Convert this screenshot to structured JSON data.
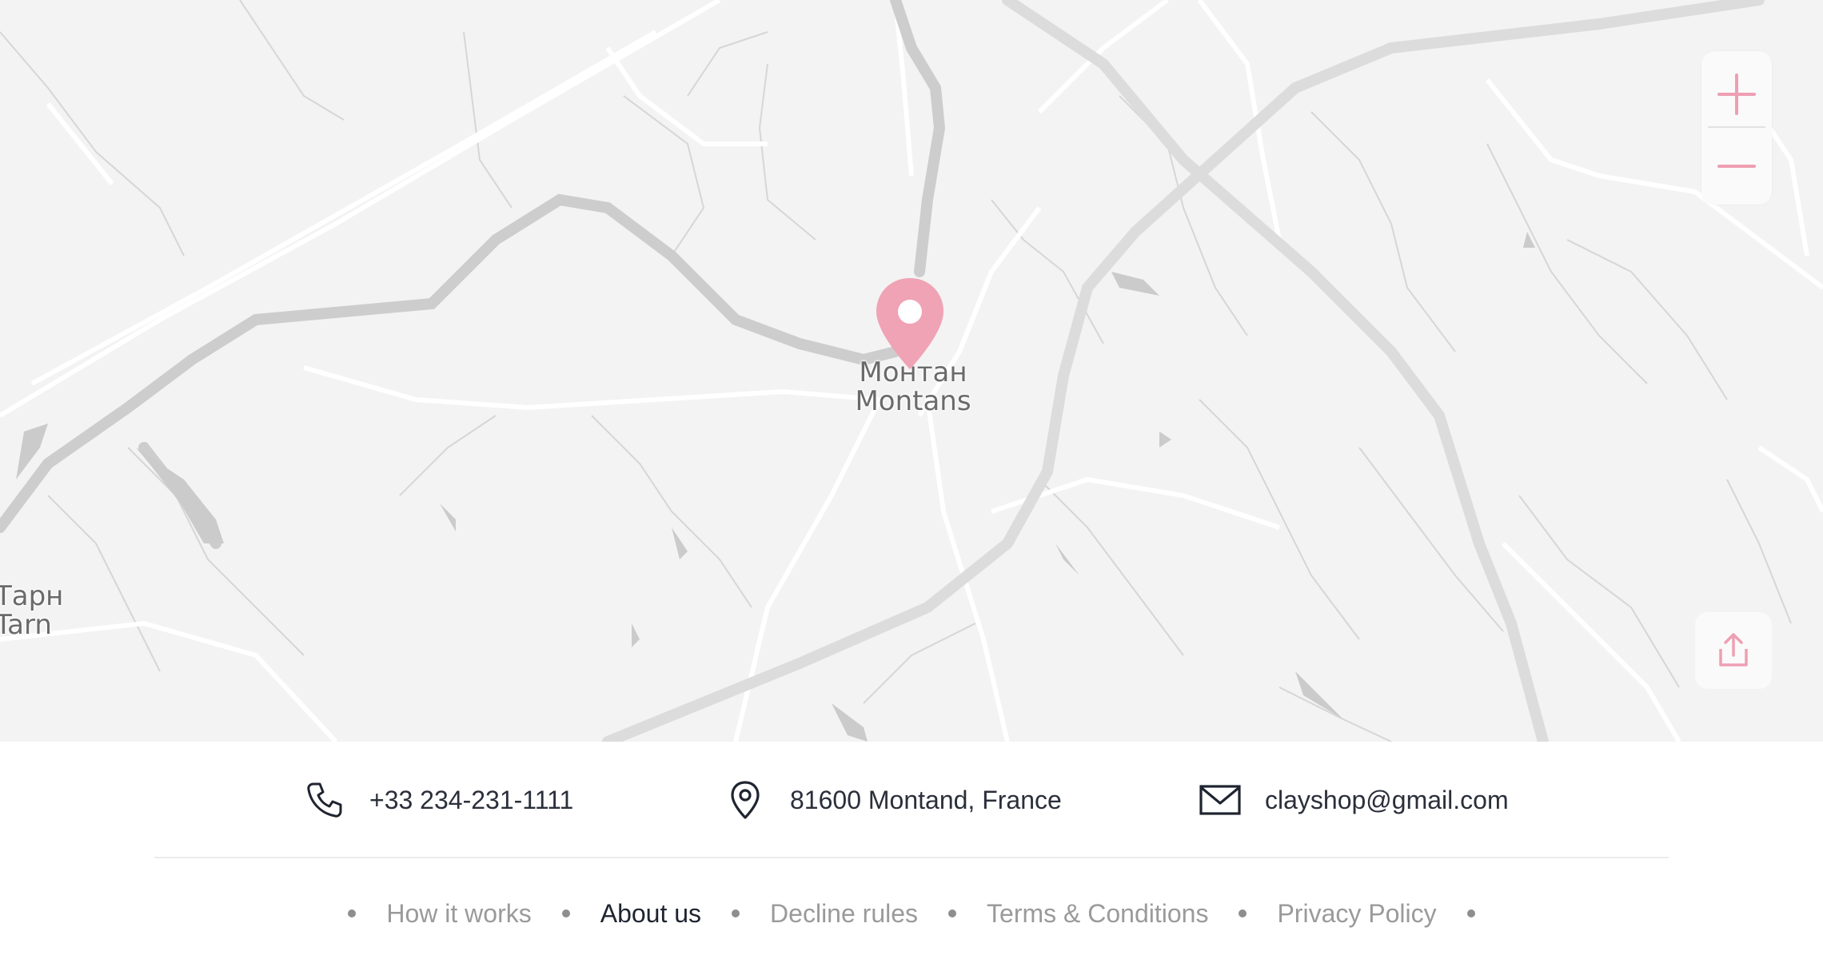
{
  "map": {
    "place_main_ru": "Монтан",
    "place_main_en": "Montans",
    "place_edge_ru": "Тарн",
    "place_edge_en": "Tarn",
    "marker_color": "#f0a3b5",
    "zoom_in_icon": "plus-icon",
    "zoom_out_icon": "minus-icon",
    "share_icon": "share-icon"
  },
  "contacts": {
    "phone": "+33 234-231-1111",
    "address": "81600 Montand, France",
    "email": "clayshop@gmail.com",
    "phone_icon": "phone-icon",
    "address_icon": "location-pin-icon",
    "email_icon": "mail-icon"
  },
  "footer_nav": {
    "items": [
      {
        "label": "How it works",
        "active": false
      },
      {
        "label": "About us",
        "active": true
      },
      {
        "label": "Decline rules",
        "active": false
      },
      {
        "label": "Terms & Conditions",
        "active": false
      },
      {
        "label": "Privacy Policy",
        "active": false
      }
    ]
  },
  "colors": {
    "accent": "#ee9fb3",
    "text_dark": "#2a2f3a",
    "text_muted": "#9a9a9a",
    "map_bg": "#f3f3f3"
  }
}
